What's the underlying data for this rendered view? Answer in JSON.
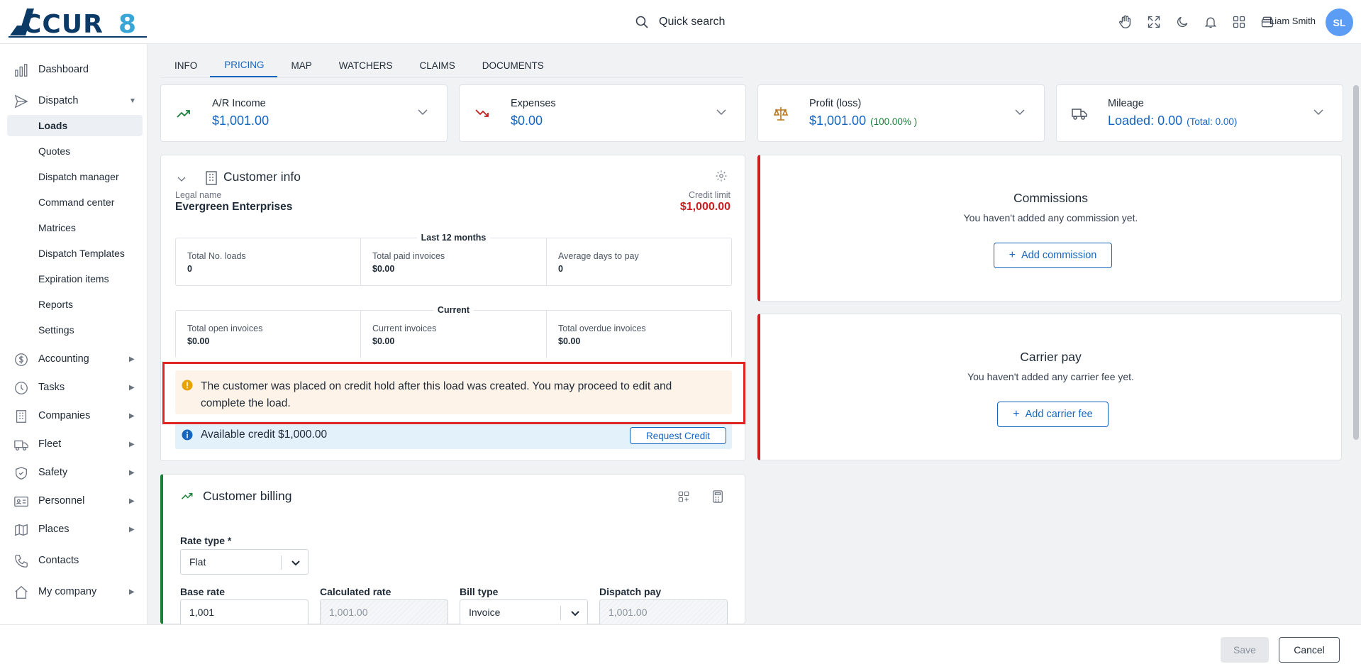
{
  "header": {
    "search_label": "Quick search",
    "user_name": "Liam Smith",
    "user_initials": "SL"
  },
  "sidebar": {
    "items": [
      {
        "label": "Dashboard"
      },
      {
        "label": "Dispatch"
      },
      {
        "label": "Accounting"
      },
      {
        "label": "Tasks"
      },
      {
        "label": "Companies"
      },
      {
        "label": "Fleet"
      },
      {
        "label": "Safety"
      },
      {
        "label": "Personnel"
      },
      {
        "label": "Places"
      },
      {
        "label": "Contacts"
      },
      {
        "label": "My company"
      }
    ],
    "dispatch_sub": [
      "Loads",
      "Quotes",
      "Dispatch manager",
      "Command center",
      "Matrices",
      "Dispatch Templates",
      "Expiration items",
      "Reports",
      "Settings"
    ]
  },
  "tabs": [
    "INFO",
    "PRICING",
    "MAP",
    "WATCHERS",
    "CLAIMS",
    "DOCUMENTS"
  ],
  "summary": {
    "ar_income": {
      "title": "A/R Income",
      "value": "$1,001.00"
    },
    "expenses": {
      "title": "Expenses",
      "value": "$0.00"
    },
    "profit": {
      "title": "Profit (loss)",
      "value": "$1,001.00",
      "percent": "(100.00% )"
    },
    "mileage": {
      "title": "Mileage",
      "value": "Loaded: 0.00",
      "total": "(Total: 0.00)"
    }
  },
  "customer_info": {
    "title": "Customer info",
    "legal_name_label": "Legal name",
    "legal_name": "Evergreen Enterprises",
    "credit_limit_label": "Credit limit",
    "credit_limit": "$1,000.00",
    "last12_caption": "Last 12 months",
    "last12": [
      {
        "label": "Total No. loads",
        "value": "0"
      },
      {
        "label": "Total paid invoices",
        "value": "$0.00"
      },
      {
        "label": "Average days to pay",
        "value": "0"
      }
    ],
    "current_caption": "Current",
    "current": [
      {
        "label": "Total open invoices",
        "value": "$0.00"
      },
      {
        "label": "Current invoices",
        "value": "$0.00"
      },
      {
        "label": "Total overdue invoices",
        "value": "$0.00"
      }
    ],
    "warning": "The customer was placed on credit hold after this load was created. You may proceed to edit and complete the load.",
    "available_credit": "Available credit $1,000.00",
    "request_credit_label": "Request Credit"
  },
  "commissions": {
    "title": "Commissions",
    "empty_text": "You haven't added any commission yet.",
    "button": "Add commission"
  },
  "carrier_pay": {
    "title": "Carrier pay",
    "empty_text": "You haven't added any carrier fee yet.",
    "button": "Add carrier fee"
  },
  "billing": {
    "title": "Customer billing",
    "rate_type_label": "Rate type *",
    "rate_type_value": "Flat",
    "base_rate_label": "Base rate",
    "base_rate_value": "1,001",
    "calculated_rate_label": "Calculated rate",
    "calculated_rate_value": "1,001.00",
    "bill_type_label": "Bill type",
    "bill_type_value": "Invoice",
    "dispatch_pay_label": "Dispatch pay",
    "dispatch_pay_value": "1,001.00"
  },
  "footer": {
    "save_label": "Save",
    "cancel_label": "Cancel"
  },
  "colors": {
    "accent": "#1565c0",
    "danger": "#c81e1e",
    "success": "#188038",
    "warning_icon": "#e8a300"
  }
}
